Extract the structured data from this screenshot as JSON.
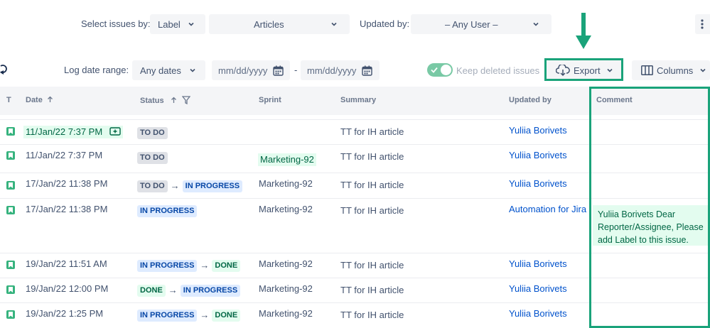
{
  "toolbar1": {
    "select_issues_label": "Select issues by:",
    "label_select": "Label",
    "articles_select": "Articles",
    "updated_by_label": "Updated by:",
    "user_select": "– Any User –"
  },
  "toolbar2": {
    "log_date_range_label": "Log date range:",
    "any_dates": "Any dates",
    "date_from_placeholder": "mm/dd/yyyy",
    "date_separator": "-",
    "date_to_placeholder": "mm/dd/yyyy",
    "keep_deleted_label": "Keep deleted issues",
    "export_label": "Export",
    "columns_label": "Columns"
  },
  "table": {
    "headers": {
      "t": "T",
      "date": "Date",
      "status": "Status",
      "sprint": "Sprint",
      "summary": "Summary",
      "updated_by": "Updated by",
      "comment": "Comment"
    },
    "rows": [
      {
        "date": "11/Jan/22 7:37 PM",
        "status_from": "TO DO",
        "status_to": "",
        "sprint": "",
        "summary": "TT for IH article",
        "updated_by": "Yuliia Borivets",
        "comment": ""
      },
      {
        "date": "11/Jan/22 7:37 PM",
        "status_from": "TO DO",
        "status_to": "",
        "sprint": "Marketing-92",
        "summary": "TT for IH article",
        "updated_by": "Yuliia Borivets",
        "comment": ""
      },
      {
        "date": "17/Jan/22 11:38 PM",
        "status_from": "TO DO",
        "status_to": "IN PROGRESS",
        "sprint": "Marketing-92",
        "summary": "TT for IH article",
        "updated_by": "Yuliia Borivets",
        "comment": ""
      },
      {
        "date": "17/Jan/22 11:38 PM",
        "status_from": "IN PROGRESS",
        "status_to": "",
        "sprint": "Marketing-92",
        "summary": "TT for IH article",
        "updated_by": "Automation for Jira",
        "comment": "Yuliia Borivets Dear Reporter/Assignee, Please add Label to this issue."
      },
      {
        "date": "19/Jan/22 11:51 AM",
        "status_from": "IN PROGRESS",
        "status_to": "DONE",
        "sprint": "Marketing-92",
        "summary": "TT for IH article",
        "updated_by": "Yuliia Borivets",
        "comment": ""
      },
      {
        "date": "19/Jan/22 12:00 PM",
        "status_from": "DONE",
        "status_to": "IN PROGRESS",
        "sprint": "Marketing-92",
        "summary": "TT for IH article",
        "updated_by": "Yuliia Borivets",
        "comment": ""
      },
      {
        "date": "19/Jan/22 1:25 PM",
        "status_from": "IN PROGRESS",
        "status_to": "DONE",
        "sprint": "Marketing-92",
        "summary": "TT for IH article",
        "updated_by": "Yuliia Borivets",
        "comment": ""
      }
    ],
    "comment_lines": [
      "Yuliia Borivets Dear",
      "Reporter/Assignee, Please",
      "add Label to this issue."
    ]
  },
  "colors": {
    "annotation_green": "#1aa37a",
    "link_blue": "#0052cc",
    "toggle_green": "#79c9a5"
  }
}
